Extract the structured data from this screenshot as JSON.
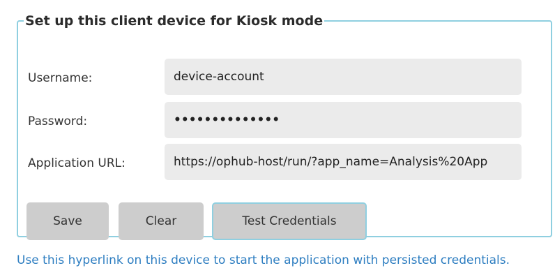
{
  "form": {
    "legend": "Set up this client device for Kiosk mode",
    "username_label": "Username:",
    "username_value": "device-account",
    "password_label": "Password:",
    "password_value": "••••••••••••••",
    "url_label": "Application URL:",
    "url_value": "https://ophub-host/run/?app_name=Analysis%20App"
  },
  "buttons": {
    "save_label": "Save",
    "clear_label": "Clear",
    "test_label": "Test Credentials"
  },
  "link": {
    "text": "Use this hyperlink on this device to start the application with persisted credentials."
  },
  "colors": {
    "border_accent": "#8fcfe0",
    "field_background": "#ebebeb",
    "button_background": "#cdcdcd",
    "link": "#2e7ec1"
  }
}
